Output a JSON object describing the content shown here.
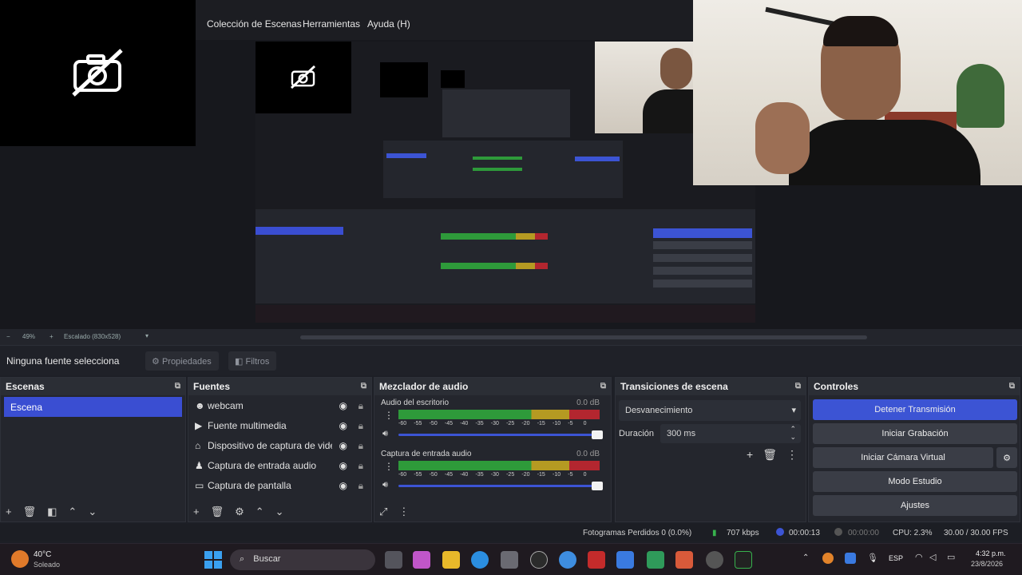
{
  "preview": {
    "menu": [
      "Colección de Escenas",
      "Herramientas",
      "Ayuda (H)"
    ],
    "zoom": "49%",
    "scale_mode": "Escalado (830x528)"
  },
  "source_bar": {
    "selected": "Ninguna fuente selecciona",
    "properties_label": "Propiedades",
    "filters_label": "Filtros"
  },
  "scenes": {
    "title": "Escenas",
    "items": [
      "Escena"
    ]
  },
  "sources": {
    "title": "Fuentes",
    "items": [
      {
        "label": "webcam",
        "icon": "webcam-icon"
      },
      {
        "label": "Fuente multimedia",
        "icon": "play-icon"
      },
      {
        "label": "Dispositivo de captura de video",
        "icon": "camera-icon"
      },
      {
        "label": "Captura de entrada audio",
        "icon": "mic-icon"
      },
      {
        "label": "Captura de pantalla",
        "icon": "monitor-icon"
      }
    ]
  },
  "mixer": {
    "title": "Mezclador de audio",
    "channels": [
      {
        "name": "Audio del escritorio",
        "db": "0.0 dB"
      },
      {
        "name": "Captura de entrada audio",
        "db": "0.0 dB"
      }
    ],
    "scale": [
      "-60",
      "-55",
      "-50",
      "-45",
      "-40",
      "-35",
      "-30",
      "-25",
      "-20",
      "-15",
      "-10",
      "-5",
      "0"
    ]
  },
  "transitions": {
    "title": "Transiciones de escena",
    "selected": "Desvanecimiento",
    "duration_label": "Duración",
    "duration_value": "300 ms"
  },
  "controls": {
    "title": "Controles",
    "stop_stream": "Detener Transmisión",
    "start_recording": "Iniciar Grabación",
    "start_virtual_cam": "Iniciar Cámara Virtual",
    "studio_mode": "Modo Estudio",
    "settings": "Ajustes"
  },
  "status": {
    "dropped_frames": "Fotogramas Perdidos 0 (0.0%)",
    "bitrate": "707 kbps",
    "stream_time": "00:00:13",
    "record_time": "00:00:00",
    "cpu": "CPU: 2.3%",
    "fps": "30.00 / 30.00 FPS"
  },
  "taskbar": {
    "weather_temp": "40°C",
    "weather_desc": "Soleado",
    "search_placeholder": "Buscar",
    "lang": "ESP",
    "time": "4:32 p.m.",
    "date": "23/8/2026"
  },
  "colors": {
    "accent": "#3c54d4",
    "meter_green": "#2e9a3a",
    "meter_yellow": "#b59a22",
    "meter_red": "#b3262f"
  }
}
